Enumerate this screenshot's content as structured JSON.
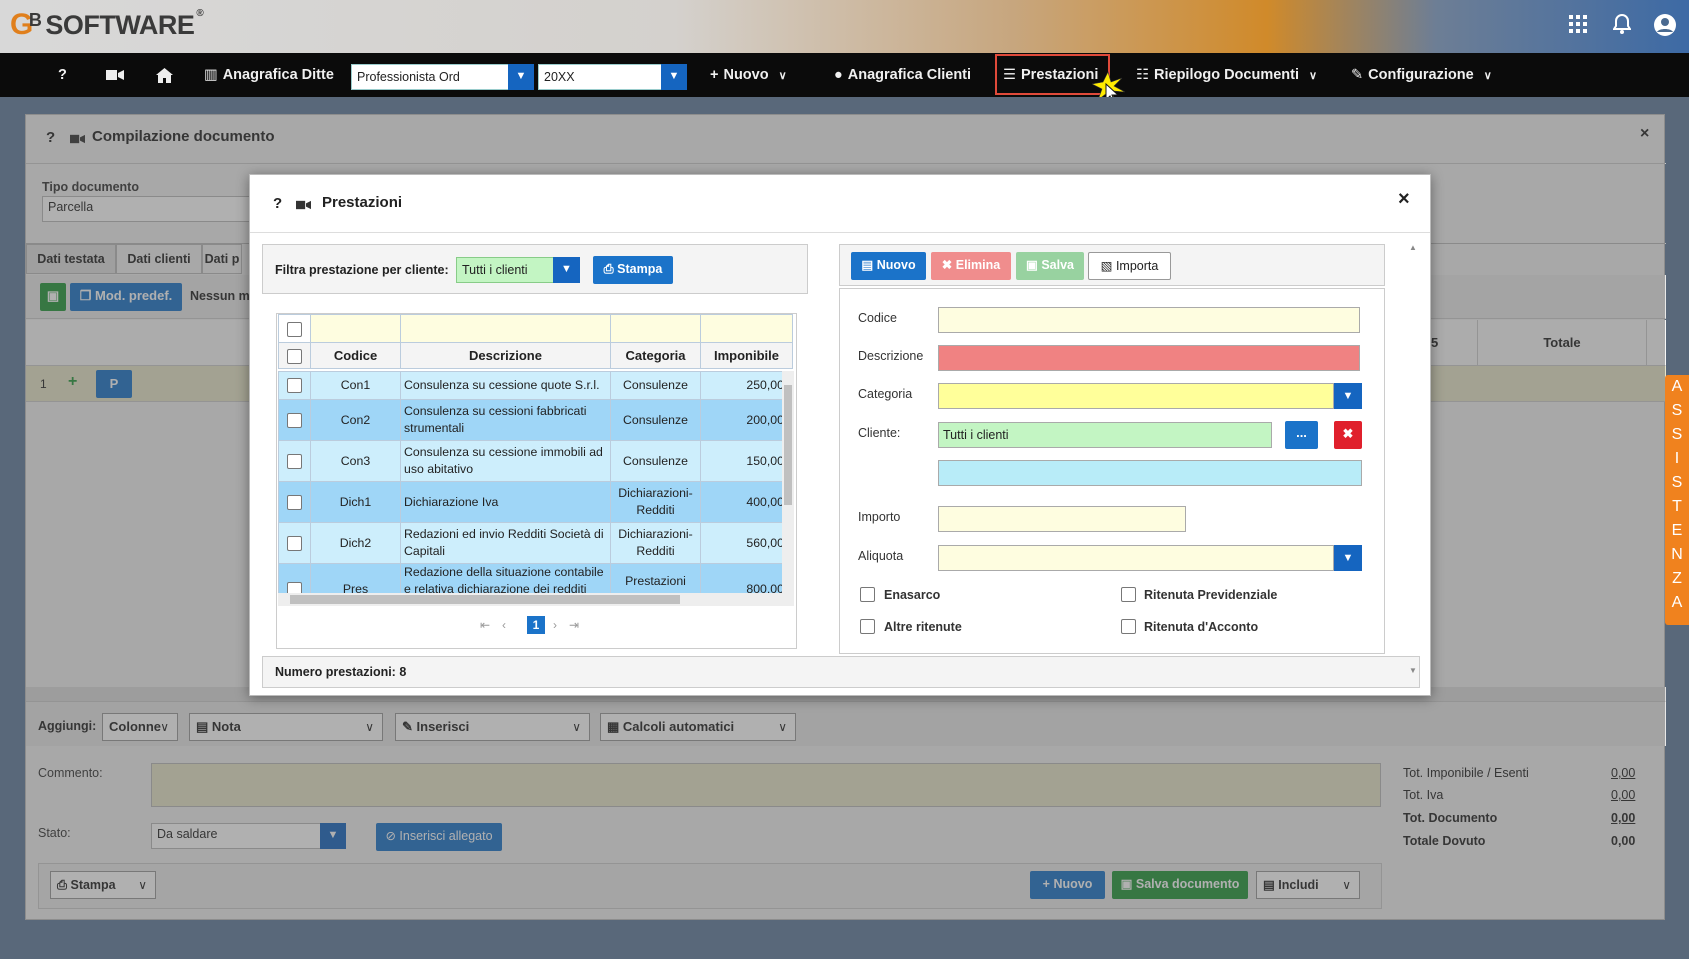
{
  "topbar": {
    "logo_g": "G",
    "logo_b": "B",
    "logo_text": "SOFTWARE",
    "logo_reg": "®",
    "icons": [
      "grid-icon",
      "bell-icon",
      "user-icon"
    ]
  },
  "nav": {
    "help": "?",
    "video_icon": "■▶",
    "home_icon": "⌂",
    "anagrafica_ditte": "Anagrafica Ditte",
    "profile_value": "Professionista Ord",
    "year_value": "20XX",
    "nuovo": "Nuovo",
    "anagrafica_clienti": "Anagrafica Clienti",
    "prestazioni": "Prestazioni",
    "riepilogo": "Riepilogo Documenti",
    "configurazione": "Configurazione"
  },
  "doc": {
    "title": "Compilazione documento",
    "tipo_label": "Tipo documento",
    "tipo_value": "Parcella",
    "tabs": [
      "Dati testata",
      "Dati clienti",
      "Dati p"
    ],
    "mod_predef": "Mod. predef.",
    "nessun_mo": "Nessun mo",
    "col_5": "5",
    "col_totale": "Totale",
    "row_num": "1",
    "row_p": "P",
    "aggiungi_label": "Aggiungi:",
    "colonne": "Colonne",
    "nota": "Nota",
    "inserisci": "Inserisci",
    "calcoli": "Calcoli automatici",
    "commento_label": "Commento:",
    "stato_label": "Stato:",
    "stato_value": "Da saldare",
    "inserisci_allegato": "Inserisci allegato",
    "stampa": "Stampa",
    "nuovo": "Nuovo",
    "salva_documento": "Salva documento",
    "includi": "Includi",
    "totals": [
      {
        "label": "Tot. Imponibile / Esenti",
        "value": "0,00"
      },
      {
        "label": "Tot. Iva",
        "value": "0,00"
      },
      {
        "label": "Tot. Documento",
        "value": "0,00"
      },
      {
        "label": "Totale Dovuto",
        "value": "0,00"
      }
    ]
  },
  "assistenza": [
    "A",
    "S",
    "S",
    "I",
    "S",
    "T",
    "E",
    "N",
    "Z",
    "A"
  ],
  "modal": {
    "title": "Prestazioni",
    "help": "?",
    "close": "×",
    "filter_label": "Filtra prestazione per cliente:",
    "filter_value": "Tutti i clienti",
    "stampa": "Stampa",
    "columns": [
      "Codice",
      "Descrizione",
      "Categoria",
      "Imponibile"
    ],
    "rows": [
      {
        "codice": "Con1",
        "descrizione": "Consulenza su cessione quote S.r.l.",
        "categoria": "Consulenze",
        "imponibile": "250,00"
      },
      {
        "codice": "Con2",
        "descrizione": "Consulenza su cessioni fabbricati strumentali",
        "categoria": "Consulenze",
        "imponibile": "200,00"
      },
      {
        "codice": "Con3",
        "descrizione": "Consulenza su cessione immobili ad uso abitativo",
        "categoria": "Consulenze",
        "imponibile": "150,00"
      },
      {
        "codice": "Dich1",
        "descrizione": "Dichiarazione Iva",
        "categoria": "Dichiarazioni-Redditi",
        "imponibile": "400,00"
      },
      {
        "codice": "Dich2",
        "descrizione": "Redazioni ed invio Redditi Società di Capitali",
        "categoria": "Dichiarazioni-Redditi",
        "imponibile": "560,00"
      },
      {
        "codice": "Pres",
        "descrizione": "Redazione della situazione contabile e relativa dichiarazione dei redditi per",
        "categoria": "Prestazioni contabili",
        "imponibile": "800,00"
      }
    ],
    "page": "1",
    "count_label": "Numero prestazioni: 8",
    "toolbar": {
      "nuovo": "Nuovo",
      "elimina": "Elimina",
      "salva": "Salva",
      "importa": "Importa"
    },
    "form": {
      "codice": "Codice",
      "descrizione": "Descrizione",
      "categoria": "Categoria",
      "cliente": "Cliente:",
      "cliente_value": "Tutti i clienti",
      "importo": "Importo",
      "aliquota": "Aliquota",
      "enasarco": "Enasarco",
      "ritenuta_prev": "Ritenuta Previdenziale",
      "altre_ritenute": "Altre ritenute",
      "ritenuta_acconto": "Ritenuta d'Acconto",
      "more": "..."
    }
  },
  "colors": {
    "accent": "#1b73c9",
    "nav_bg": "#0b0b0b",
    "row_a": "#cdeefc",
    "row_b": "#9fd6f7",
    "desc_field": "#f08282",
    "cat_field": "#ffff9a",
    "client_field": "#c3f5c3",
    "highlight": "#e04a3a"
  }
}
